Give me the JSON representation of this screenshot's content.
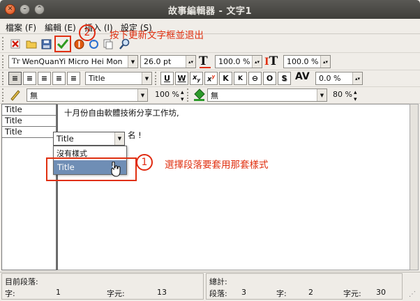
{
  "window": {
    "title": "故事編輯器 - 文字1",
    "close_glyph": "✕",
    "min_glyph": "–",
    "max_glyph": "⌃"
  },
  "menu": [
    {
      "label": "檔案 (F)"
    },
    {
      "label": "編輯 (E)"
    },
    {
      "label": "插入 (I)"
    },
    {
      "label": "設定 (S)"
    }
  ],
  "font": {
    "family": "WenQuanYi Micro Hei Mon",
    "size": "26.0 pt",
    "scale_h": "100.0 %",
    "scale_v": "100.0 %"
  },
  "paragraph": {
    "style": "Title",
    "kerning": "0.0 %"
  },
  "color_bar": {
    "stroke_color": "無",
    "stroke_shade": "100 %",
    "fill_color": "無",
    "fill_shade": "80 %"
  },
  "left_panel": {
    "rows": [
      "Title",
      "Title",
      "Title"
    ]
  },
  "document": {
    "line1": "十月份自由軟體技術分享工作坊,",
    "line2_visible": "名 !"
  },
  "style_dropdown": {
    "current": "Title",
    "options": [
      "沒有樣式",
      "Title"
    ],
    "selected_index": 1
  },
  "annotations": {
    "one": {
      "number": "1",
      "text": "選擇段落要套用那套樣式"
    },
    "two": {
      "number": "2",
      "text": "按下更新文字框並退出"
    }
  },
  "status": {
    "current_paragraph_label": "目前段落:",
    "chars_label": "字:",
    "chars_value": "1",
    "glyphs_label": "字元:",
    "glyphs_value": "13",
    "total_label": "總計:",
    "paragraphs_label": "段落:",
    "paragraphs_value": "3",
    "words_label": "字:",
    "words_value": "2",
    "total_glyphs_label": "字元:",
    "total_glyphs_value": "30"
  },
  "colors": {
    "accent_red": "#e03010",
    "selection_blue": "#6f8eb5"
  }
}
